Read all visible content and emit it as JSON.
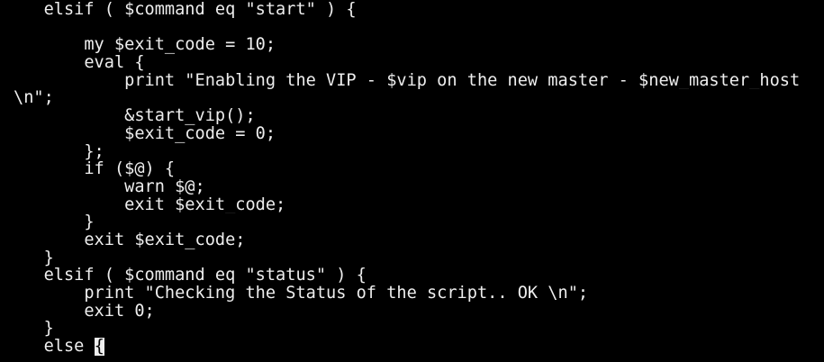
{
  "terminal": {
    "lines": [
      "   elsif ( $command eq \"start\" ) {",
      "",
      "       my $exit_code = 10;",
      "       eval {",
      "           print \"Enabling the VIP - $vip on the new master - $new_master_host",
      "\\n\";",
      "           &start_vip();",
      "           $exit_code = 0;",
      "       };",
      "       if ($@) {",
      "           warn $@;",
      "           exit $exit_code;",
      "       }",
      "       exit $exit_code;",
      "   }",
      "   elsif ( $command eq \"status\" ) {",
      "       print \"Checking the Status of the script.. OK \\n\";",
      "       exit 0;",
      "   }",
      "   else "
    ],
    "cursor_char": "{",
    "colors": {
      "background": "#000000",
      "foreground": "#eeeeee"
    }
  }
}
